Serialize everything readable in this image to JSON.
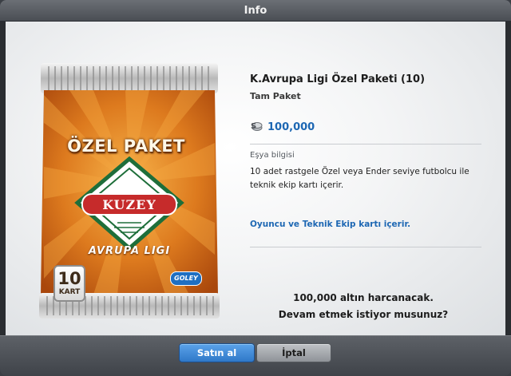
{
  "window": {
    "title": "Info"
  },
  "pack": {
    "title": "ÖZEL PAKET",
    "brand": "KUZEY",
    "league": "AVRUPA LIGI",
    "count": "10",
    "count_label": "KART",
    "logo": "GOLEY"
  },
  "item": {
    "name": "K.Avrupa Ligi Özel Paketi (10)",
    "subtitle": "Tam Paket",
    "currency_icon": "coin-icon",
    "price": "100,000",
    "info_heading": "Eşya bilgisi",
    "description": "10 adet rastgele Özel veya Ender seviye futbolcu ile teknik ekip kartı içerir.",
    "link": "Oyuncu ve Teknik Ekip kartı içerir."
  },
  "confirm": {
    "line1": "100,000 altın harcanacak.",
    "line2": "Devam etmek istiyor musunuz?"
  },
  "buttons": {
    "buy": "Satın al",
    "cancel": "İptal"
  },
  "colors": {
    "accent_blue": "#1d67b3",
    "pack_orange": "#d9781f",
    "badge_green": "#1e6e3a",
    "badge_red": "#c62b2b"
  }
}
